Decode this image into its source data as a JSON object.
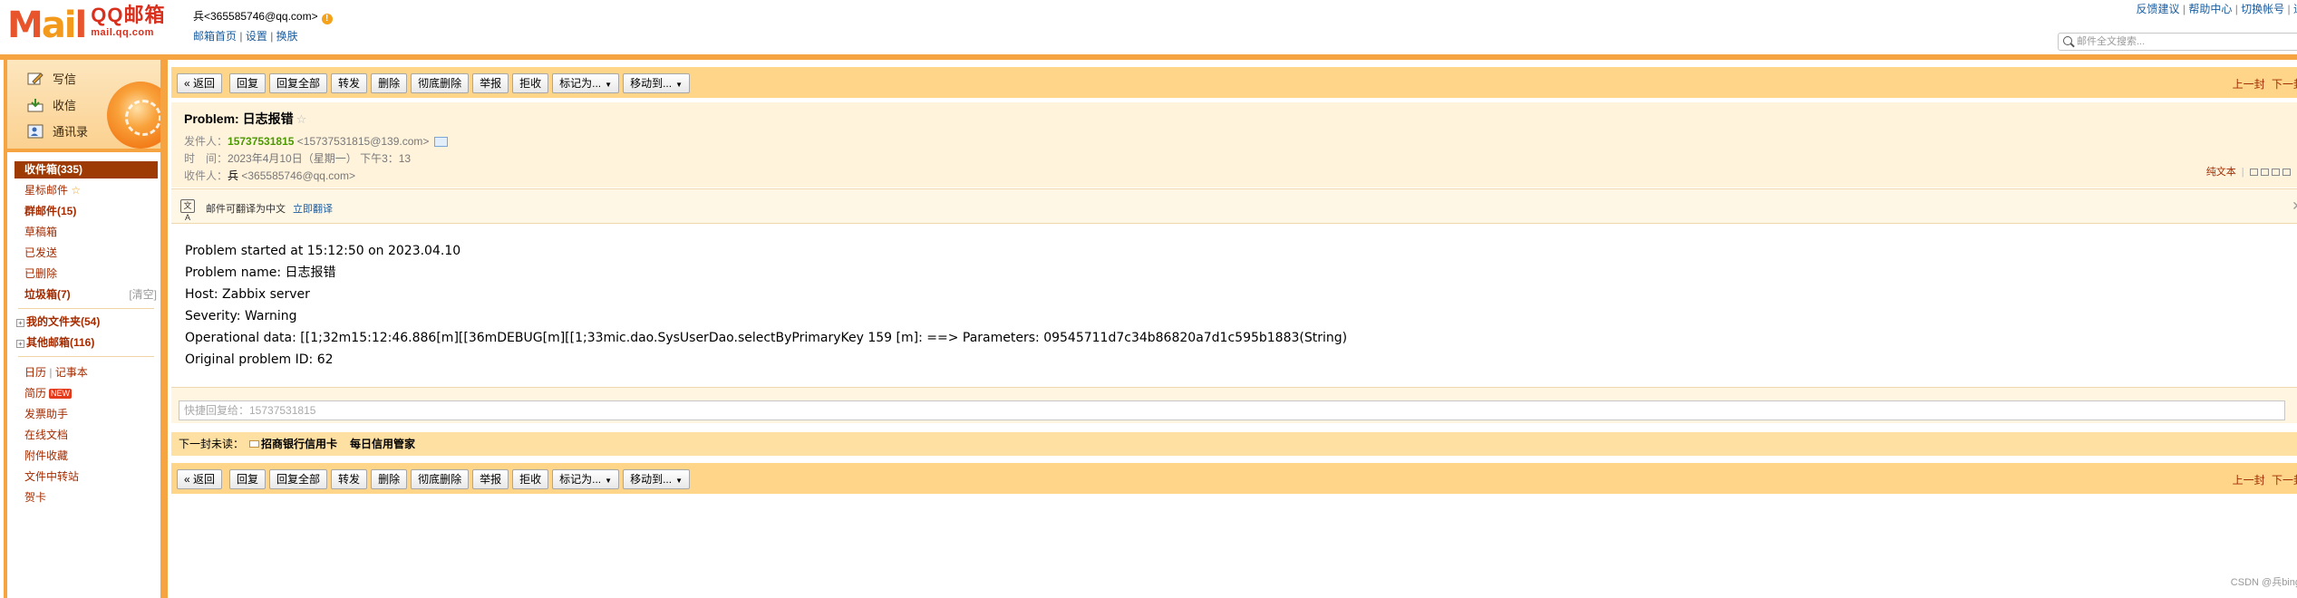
{
  "brand": {
    "logo_letters": "M",
    "logo_mid": "ai",
    "logo_end": "l",
    "logo_cn": "QQ邮箱",
    "logo_url": "mail.qq.com"
  },
  "account": {
    "address": "兵<365585746@qq.com>",
    "home": "邮箱首页",
    "settings": "设置",
    "skin": "换肤",
    "sep": "|"
  },
  "toplinks": {
    "feedback": "反馈建议",
    "help": "帮助中心",
    "switch": "切换帐号",
    "logout": "退出",
    "sep": "|"
  },
  "search": {
    "placeholder": "邮件全文搜索..."
  },
  "sidebar": {
    "compose": "写信",
    "receive": "收信",
    "contacts": "通讯录",
    "folders": {
      "inbox": "收件箱(335)",
      "starred": "星标邮件",
      "group": "群邮件(15)",
      "drafts": "草稿箱",
      "sent": "已发送",
      "deleted": "已删除",
      "spam": "垃圾箱(7)",
      "spam_empty": "[清空]",
      "myfolders": "我的文件夹(54)",
      "other": "其他邮箱(116)"
    },
    "tools": {
      "calendar": "日历",
      "notes": "记事本",
      "resume": "简历",
      "new_badge": "NEW",
      "invoice": "发票助手",
      "docs": "在线文档",
      "attachments": "附件收藏",
      "transfer": "文件中转站",
      "cards": "贺卡"
    }
  },
  "toolbar": {
    "back": "« 返回",
    "reply": "回复",
    "reply_all": "回复全部",
    "forward": "转发",
    "delete": "删除",
    "delete_perm": "彻底删除",
    "report": "举报",
    "reject": "拒收",
    "mark_as": "标记为...",
    "move_to": "移动到...",
    "prev": "上一封",
    "next": "下一封"
  },
  "mail": {
    "subject": "Problem: 日志报错",
    "from_label": "发件人：",
    "from_name": "15737531815",
    "from_addr": "<15737531815@139.com>",
    "time_label": "时　间：",
    "time": "2023年4月10日（星期一） 下午3：13",
    "to_label": "收件人：",
    "to_name": "兵",
    "to_addr": "<365585746@qq.com>",
    "plain_text": "纯文本",
    "sep": "|"
  },
  "translate": {
    "text": "邮件可翻译为中文",
    "link": "立即翻译",
    "icon_text": "文A"
  },
  "body_lines": [
    "Problem started at 15:12:50 on 2023.04.10",
    "Problem name: 日志报错",
    "Host: Zabbix server",
    "Severity: Warning",
    "Operational data: [[1;32m15:12:46.886[m][[36mDEBUG[m][[1;33mic.dao.SysUserDao.selectByPrimaryKey 159 [m]: ==> Parameters: 09545711d7c34b86820a7d1c595b1883(String)",
    "Original problem ID: 62"
  ],
  "quick_reply": {
    "placeholder": "快捷回复给：15737531815"
  },
  "unread": {
    "label": "下一封未读：",
    "item1": "招商银行信用卡",
    "item2": "每日信用管家"
  },
  "watermark": "CSDN @兵bing"
}
